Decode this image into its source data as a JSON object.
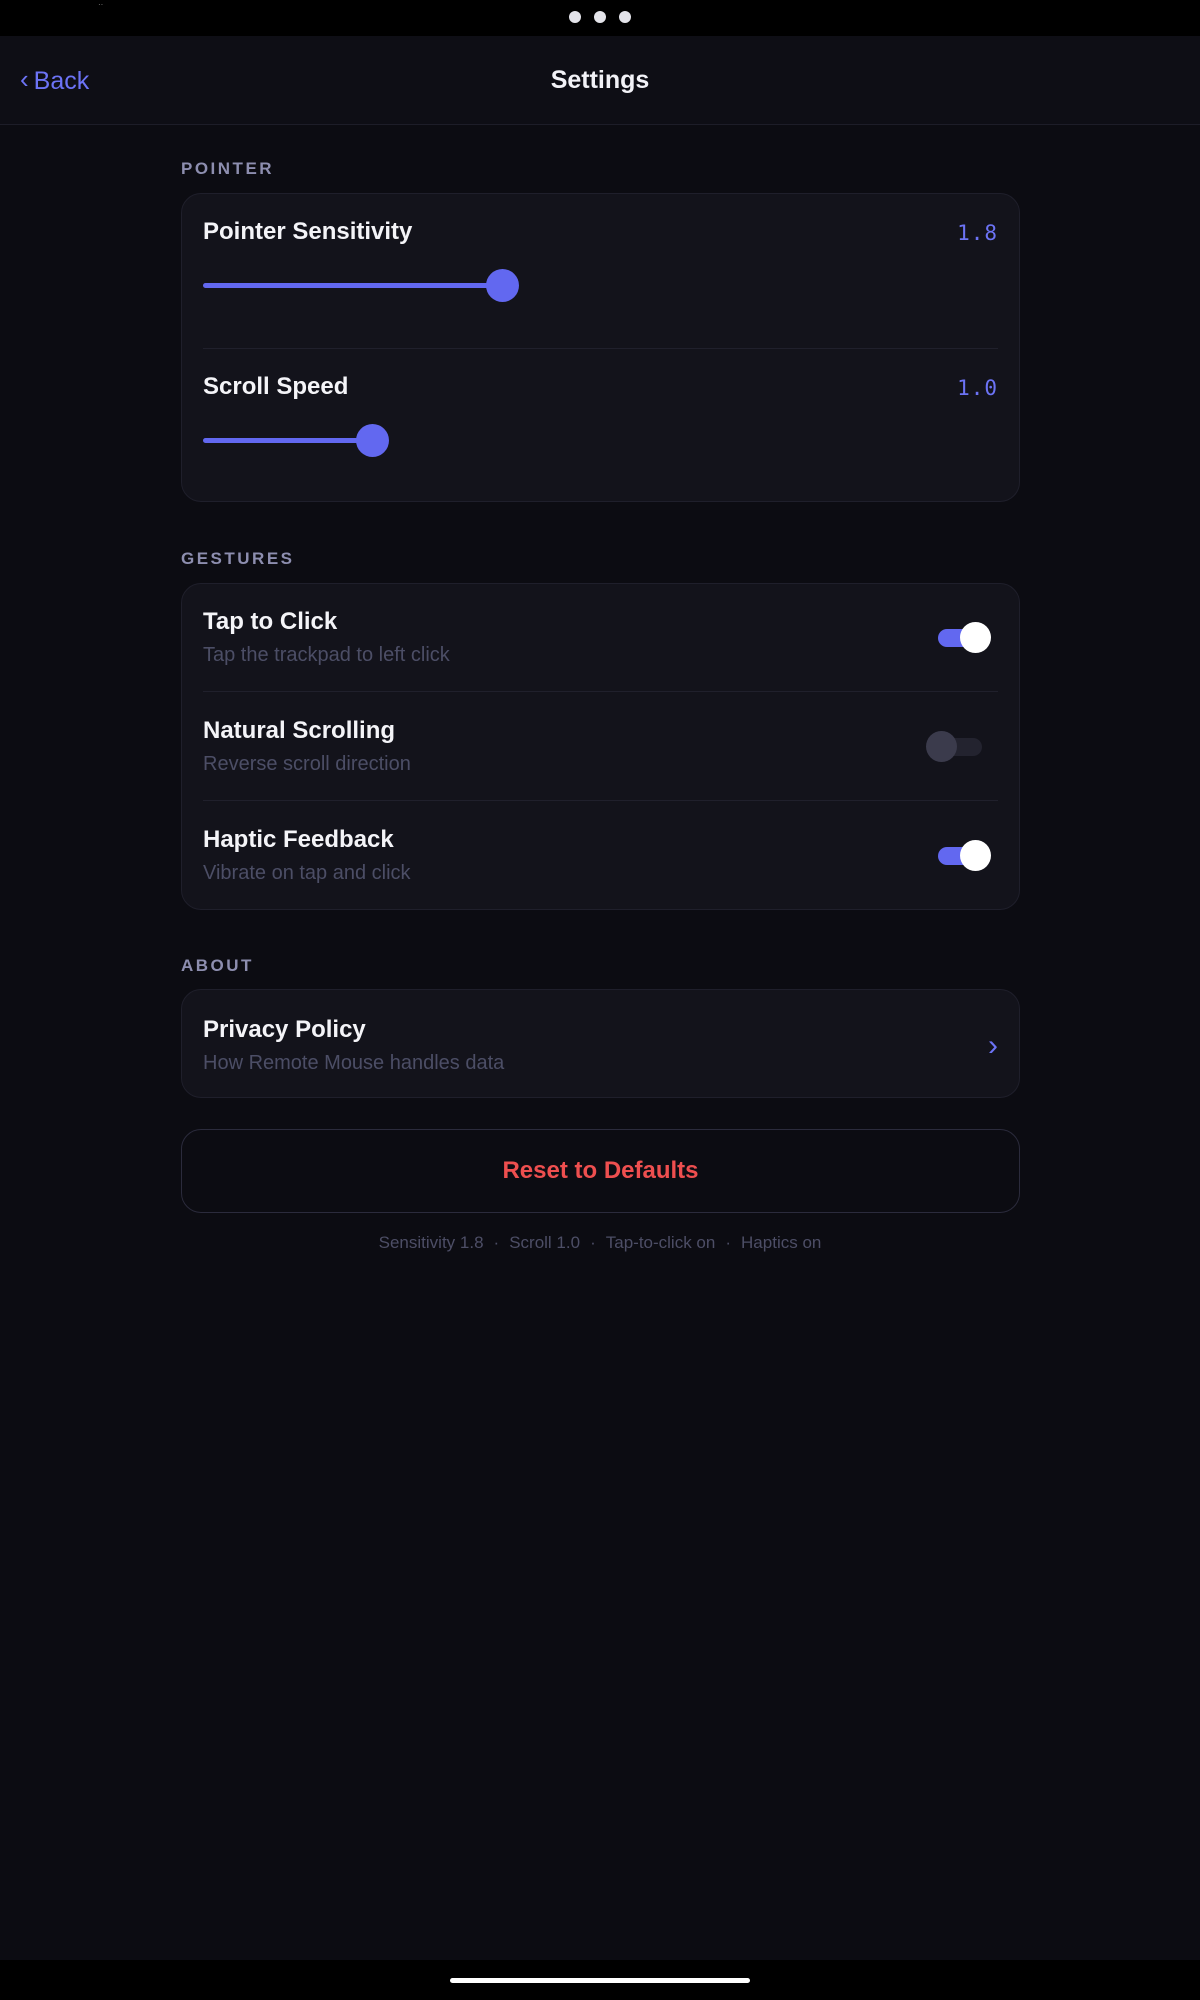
{
  "nav": {
    "back_label": "Back",
    "title": "Settings"
  },
  "pointer": {
    "section_label": "POINTER",
    "sensitivity": {
      "label": "Pointer Sensitivity",
      "value": "1.8",
      "fraction": 0.48
    },
    "scroll_speed": {
      "label": "Scroll Speed",
      "value": "1.0",
      "fraction": 0.27
    }
  },
  "gestures": {
    "section_label": "GESTURES",
    "items": [
      {
        "title": "Tap to Click",
        "subtitle": "Tap the trackpad to left click",
        "enabled": true
      },
      {
        "title": "Natural Scrolling",
        "subtitle": "Reverse scroll direction",
        "enabled": false
      },
      {
        "title": "Haptic Feedback",
        "subtitle": "Vibrate on tap and click",
        "enabled": true
      }
    ]
  },
  "about": {
    "section_label": "ABOUT",
    "privacy": {
      "title": "Privacy Policy",
      "subtitle": "How Remote Mouse handles data"
    }
  },
  "reset_label": "Reset to Defaults",
  "summary": {
    "sensitivity": "Sensitivity 1.8",
    "scroll": "Scroll 1.0",
    "tap": "Tap-to-click on",
    "haptics": "Haptics on",
    "separator": "·"
  },
  "colors": {
    "accent": "#6268f0",
    "danger": "#ee4f4f",
    "background": "#0c0c12",
    "card": "#13131b"
  },
  "icons": {
    "back": "chevron-left-icon",
    "disclosure": "chevron-right-icon"
  }
}
